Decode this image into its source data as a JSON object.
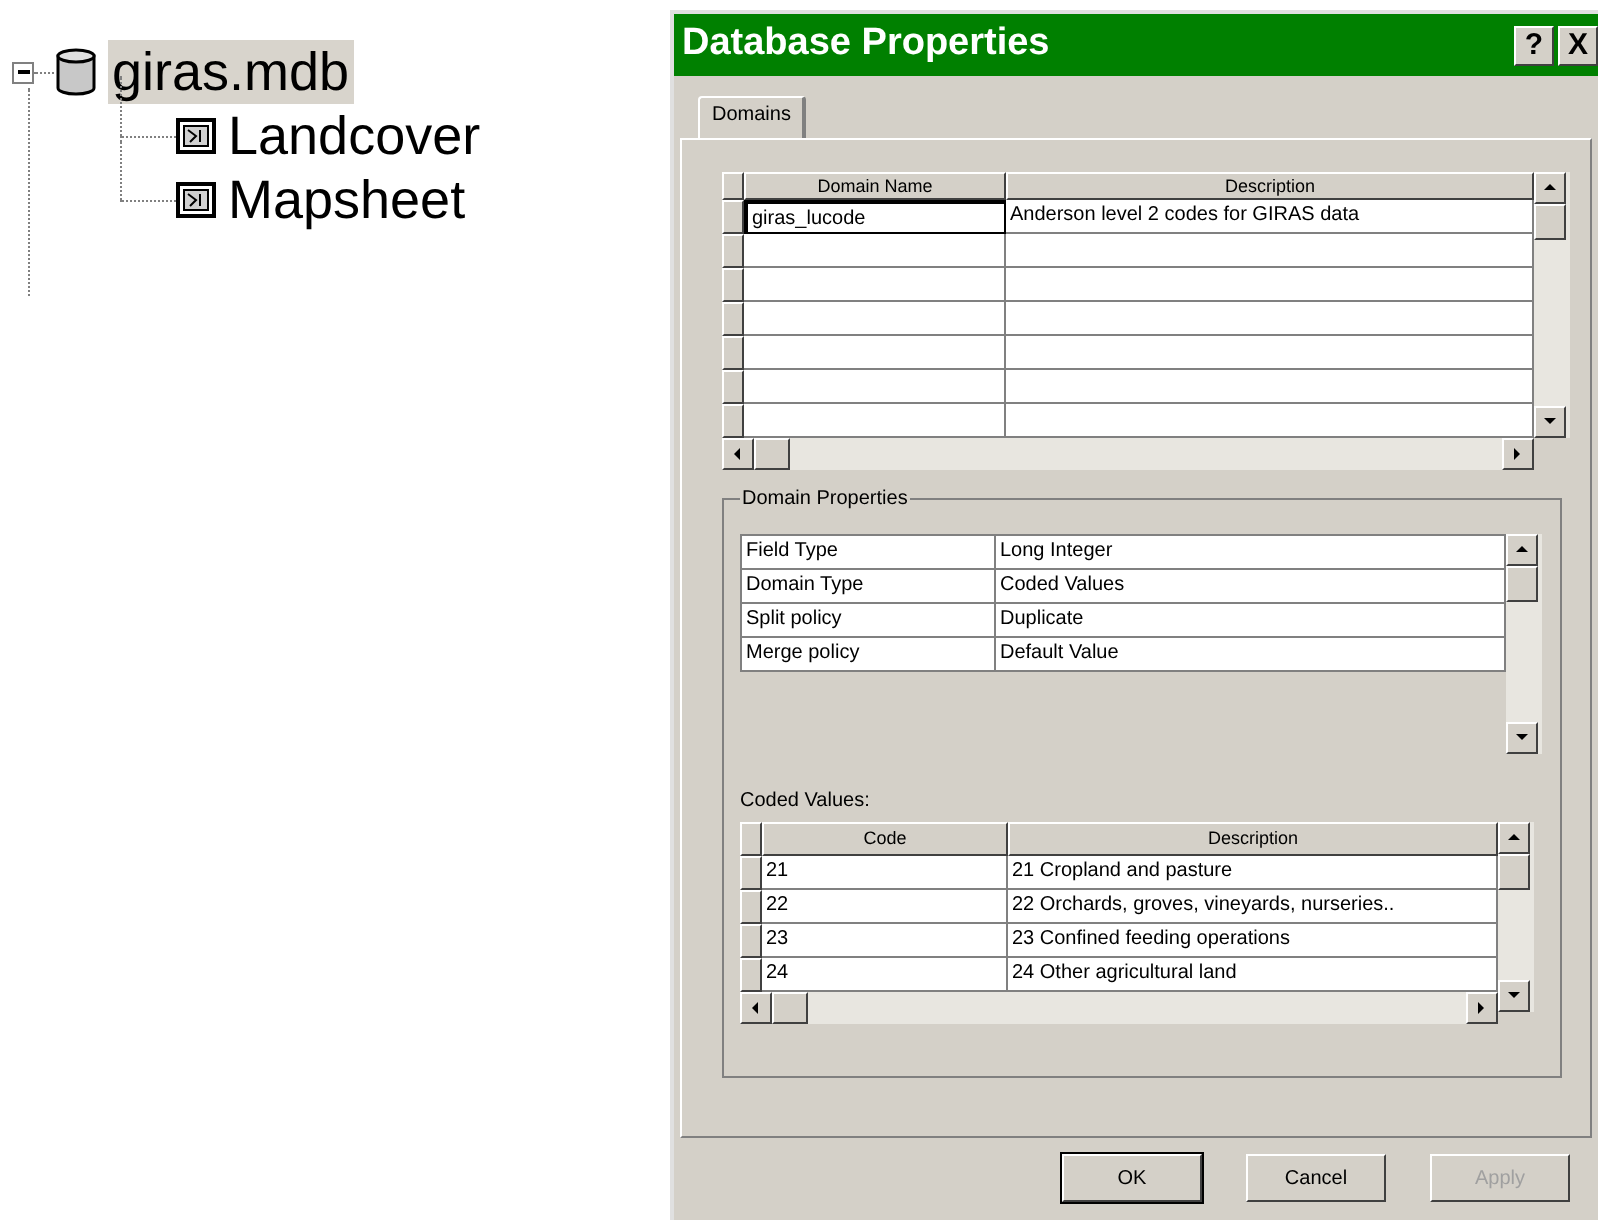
{
  "tree": {
    "label": "giras.mdb",
    "expanded": true,
    "selected": true,
    "children": [
      {
        "label": "Landcover",
        "selected": false
      },
      {
        "label": "Mapsheet",
        "selected": false
      }
    ]
  },
  "dialog": {
    "title": "Database Properties",
    "help": "?",
    "close": "X",
    "tabs": [
      {
        "label": "Domains",
        "selected": true
      }
    ],
    "domains": {
      "columns": [
        "Domain Name",
        "Description"
      ],
      "rows": [
        {
          "name": "giras_lucode",
          "description": "Anderson level 2 codes for GIRAS data"
        }
      ]
    },
    "domain_properties": {
      "title": "Domain Properties",
      "rows": [
        {
          "property": "Field Type",
          "value": "Long Integer"
        },
        {
          "property": "Domain Type",
          "value": "Coded Values"
        },
        {
          "property": "Split policy",
          "value": "Duplicate"
        },
        {
          "property": "Merge policy",
          "value": "Default Value"
        }
      ]
    },
    "coded_values": {
      "label": "Coded Values:",
      "columns": [
        "Code",
        "Description"
      ],
      "rows": [
        {
          "code": "21",
          "description": "21 Cropland and pasture"
        },
        {
          "code": "22",
          "description": "22 Orchards, groves, vineyards, nurseries.."
        },
        {
          "code": "23",
          "description": "23 Confined feeding operations"
        },
        {
          "code": "24",
          "description": "24 Other agricultural land"
        }
      ]
    },
    "buttons": [
      {
        "label": "OK",
        "default": true,
        "disabled": false
      },
      {
        "label": "Cancel",
        "default": false,
        "disabled": false
      },
      {
        "label": "Apply",
        "default": false,
        "disabled": true
      }
    ]
  }
}
